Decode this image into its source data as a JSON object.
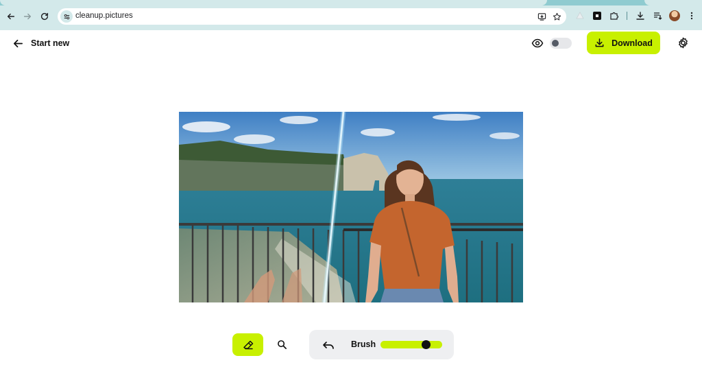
{
  "browser": {
    "url": "cleanup.pictures"
  },
  "header": {
    "start_new_label": "Start new",
    "download_label": "Download",
    "compare_toggle_on": false
  },
  "toolbar": {
    "brush_label": "Brush",
    "brush_size_fraction": 0.73
  },
  "colors": {
    "accent": "#c8f000",
    "chrome_bg": "#d3e9ea",
    "panel_bg": "#eeeff1"
  },
  "icons": {
    "back": "arrow-left-icon",
    "eye": "eye-icon",
    "download": "download-icon",
    "settings": "gear-icon",
    "eraser": "eraser-icon",
    "zoom": "magnifier-icon",
    "undo": "undo-icon"
  }
}
